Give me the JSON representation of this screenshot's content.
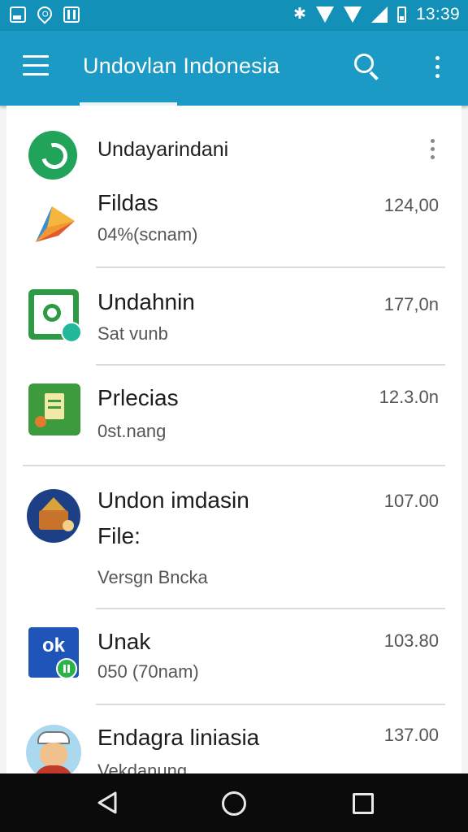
{
  "status_bar": {
    "time": "13:39",
    "icons": [
      "gallery-icon",
      "location-icon",
      "news-icon",
      "bluetooth-icon",
      "wifi-icon",
      "signal-icon",
      "battery-icon"
    ]
  },
  "app_bar": {
    "title": "Undovlan Indonesia",
    "icons": [
      "menu-icon",
      "search-icon",
      "more-vert-icon"
    ]
  },
  "header": {
    "title": "Undayarindani",
    "icon": "whatsapp-icon"
  },
  "items": [
    {
      "title": "Fildas",
      "subtitle": "04%(scnam)",
      "value": "124,00",
      "icon": "play-icon"
    },
    {
      "title": "Undahnin",
      "subtitle": "Sat vunb",
      "value": "177,0n",
      "icon": "camera-icon"
    },
    {
      "title": "Prlecias",
      "subtitle": "0st.nang",
      "value": "12.3.0n",
      "icon": "notes-icon"
    },
    {
      "title": "Undon imdasin",
      "file": "File:",
      "subtitle": "Versgn Bncka",
      "value": "107.00",
      "icon": "temple-icon"
    },
    {
      "title": "Unak",
      "subtitle": "050 (70nam)",
      "value": "103.80",
      "icon": "ok-icon",
      "icon_text": "ok"
    },
    {
      "title": "Endagra liniasia",
      "subtitle": "Vekdanung",
      "value": "137.00",
      "icon": "avatar-icon"
    }
  ],
  "colors": {
    "status_bar": "#1290b8",
    "app_bar": "#1a9ac4",
    "nav_bar": "#0b0b0b",
    "whatsapp": "#21a35a"
  }
}
